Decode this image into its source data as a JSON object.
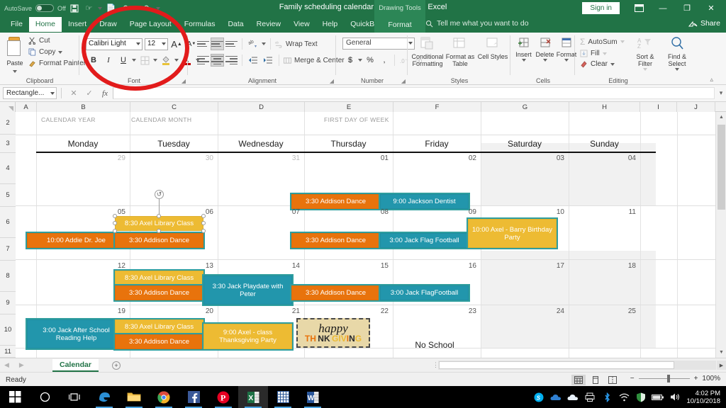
{
  "titlebar": {
    "autosave_label": "AutoSave",
    "autosave_state": "Off",
    "save_icon": "save-icon",
    "touch_icon": "touch-mode-icon",
    "undo_icon": "undo-icon",
    "redo_icon": "redo-icon",
    "document_title": "Family scheduling calendar example.xlsx  -  Excel",
    "contextual_tool": "Drawing Tools",
    "sign_in": "Sign in",
    "ribbon_display_icon": "ribbon-display-options-icon",
    "minimize_icon": "minimize-icon",
    "restore_icon": "restore-icon",
    "close_icon": "close-icon"
  },
  "ribbon_tabs": {
    "items": [
      "File",
      "Home",
      "Insert",
      "Draw",
      "Page Layout",
      "Formulas",
      "Data",
      "Review",
      "View",
      "Help",
      "QuickBooks"
    ],
    "active": "Home",
    "contextual_tab": "Format",
    "tell_me": "Tell me what you want to do",
    "share": "Share"
  },
  "ribbon": {
    "clipboard": {
      "label": "Clipboard",
      "paste": "Paste",
      "cut": "Cut",
      "copy": "Copy",
      "format_painter": "Format Painter"
    },
    "font": {
      "label": "Font",
      "font_name": "Calibri Light",
      "font_size": "12",
      "bold": "B",
      "italic": "I",
      "underline": "U",
      "grow_font": "A",
      "shrink_font": "A",
      "borders": "borders-icon",
      "fill_color": "fill-color-icon",
      "font_color": "font-color-icon"
    },
    "alignment": {
      "label": "Alignment",
      "wrap_text": "Wrap Text",
      "merge_center": "Merge & Center",
      "orientation": "orientation-icon",
      "decrease_indent": "decrease-indent-icon",
      "increase_indent": "increase-indent-icon"
    },
    "number": {
      "label": "Number",
      "format": "General",
      "currency": "$",
      "percent": "%",
      "comma": ",",
      "increase_decimal": "increase-decimal-icon",
      "decrease_decimal": "decrease-decimal-icon"
    },
    "styles": {
      "label": "Styles",
      "conditional_formatting": "Conditional Formatting",
      "format_as_table": "Format as Table",
      "cell_styles": "Cell Styles"
    },
    "cells": {
      "label": "Cells",
      "insert": "Insert",
      "delete": "Delete",
      "format": "Format"
    },
    "editing": {
      "label": "Editing",
      "autosum": "AutoSum",
      "fill": "Fill",
      "clear": "Clear",
      "sort_filter": "Sort & Filter",
      "find_select": "Find & Select"
    }
  },
  "formula_bar": {
    "name_box": "Rectangle...",
    "cancel_icon": "cancel-icon",
    "enter_icon": "confirm-icon",
    "function_icon": "insert-function-icon",
    "formula_value": ""
  },
  "grid": {
    "columns": [
      "A",
      "B",
      "C",
      "D",
      "E",
      "F",
      "G",
      "H",
      "I",
      "J"
    ],
    "rows": [
      "2",
      "3",
      "4",
      "5",
      "6",
      "7",
      "8",
      "9",
      "10",
      "11"
    ]
  },
  "calendar": {
    "field_labels": {
      "year": "CALENDAR YEAR",
      "month": "CALENDAR MONTH",
      "first_day": "FIRST DAY OF WEEK"
    },
    "day_headers": [
      "Monday",
      "Tuesday",
      "Wednesday",
      "Thursday",
      "Friday",
      "Saturday",
      "Sunday"
    ],
    "weeks": [
      {
        "dates": [
          "29",
          "30",
          "31",
          "01",
          "02",
          "03",
          "04"
        ],
        "muted": [
          true,
          true,
          true,
          false,
          false,
          false,
          false
        ]
      },
      {
        "dates": [
          "05",
          "06",
          "07",
          "08",
          "09",
          "10",
          "11"
        ],
        "muted": [
          false,
          false,
          false,
          false,
          false,
          false,
          false
        ]
      },
      {
        "dates": [
          "12",
          "13",
          "14",
          "15",
          "16",
          "17",
          "18"
        ],
        "muted": [
          false,
          false,
          false,
          false,
          false,
          false,
          false
        ]
      },
      {
        "dates": [
          "19",
          "20",
          "21",
          "22",
          "23",
          "24",
          "25"
        ],
        "muted": [
          false,
          false,
          false,
          false,
          false,
          false,
          false
        ]
      }
    ],
    "events": {
      "w1_thu_dance": "3:30 Addison Dance",
      "w1_fri_dentist": "9:00 Jackson Dentist",
      "w2_mon_addie": "10:00 Addie Dr. Joe",
      "w2_tue_library": "8:30 Axel Library Class",
      "w2_tue_dance": "3:30 Addison Dance",
      "w2_thu_dance": "3:30 Addison Dance",
      "w2_fri_football": "3:00 Jack Flag Football",
      "w2_sat_birthday": "10:00 Axel - Barry Birthday Party",
      "w3_tue_library": "8:30 Axel Library Class",
      "w3_tue_dance": "3:30 Addison Dance",
      "w3_wed_playdate": "3:30 Jack Playdate with Peter",
      "w3_thu_dance": "3:30 Addison Dance",
      "w3_fri_football": "3:00 Jack FlagFootball",
      "w4_mon_reading": "3:00 Jack After School Reading Help",
      "w4_tue_library": "8:30 Axel Library Class",
      "w4_tue_dance": "3:30 Addison Dance",
      "w4_wed_party": "9:00 Axel - class Thanksgiving Party",
      "w4_thu_image_top": "happy",
      "w4_thu_image_bottom": "THANKSGIVING",
      "w4_fri_noschool": "No School"
    },
    "colors": {
      "orange": "#e8730c",
      "teal": "#2296ac",
      "gold": "#edbb33",
      "selection": "#2f9e9e"
    }
  },
  "sheet_tabs": {
    "active": "Calendar",
    "add_label": "+",
    "prev_icon": "previous-sheet-icon",
    "next_icon": "next-sheet-icon"
  },
  "status_bar": {
    "state": "Ready",
    "normal_view_icon": "normal-view-icon",
    "page_layout_icon": "page-layout-view-icon",
    "page_break_icon": "page-break-preview-icon",
    "zoom_out": "−",
    "zoom_in": "+",
    "zoom_level": "100%"
  },
  "taskbar": {
    "start_icon": "windows-start-icon",
    "search_icon": "cortana-search-icon",
    "taskview_icon": "task-view-icon",
    "apps": [
      "edge-icon",
      "file-explorer-icon",
      "chrome-icon",
      "facebook-icon",
      "pinterest-icon",
      "excel-icon",
      "calculator-icon",
      "word-icon"
    ],
    "tray": [
      "skype-icon",
      "onedrive-blue-icon",
      "onedrive-white-icon",
      "printer-icon",
      "bluetooth-icon",
      "wifi-icon",
      "security-icon",
      "battery-icon",
      "volume-icon"
    ],
    "time": "4:02 PM",
    "date": "10/10/2018"
  },
  "annotation": {
    "shape": "red-ellipse-highlight"
  }
}
